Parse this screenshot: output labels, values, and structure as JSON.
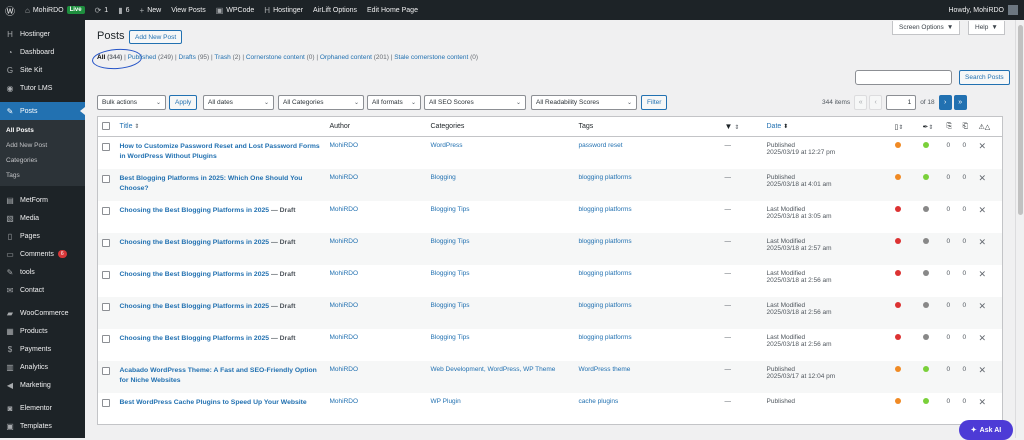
{
  "adminbar": {
    "site_name": "MohiRDO",
    "live_badge": "Live",
    "updates_count": "1",
    "comments_count": "6",
    "new_label": "New",
    "view_posts": "View Posts",
    "wpcode": "WPCode",
    "hostinger": "Hostinger",
    "airlift": "AirLift Options",
    "edit_home": "Edit Home Page",
    "howdy": "Howdy, MohiRDO"
  },
  "sidebar": {
    "items": [
      {
        "label": "Hostinger",
        "icon": "hostinger-icon"
      },
      {
        "label": "Dashboard",
        "icon": "dashboard-icon"
      },
      {
        "label": "Site Kit",
        "icon": "sitekit-icon"
      },
      {
        "label": "Tutor LMS",
        "icon": "tutor-icon"
      },
      {
        "label": "Posts",
        "icon": "pin-icon"
      },
      {
        "label": "MetForm",
        "icon": "form-icon"
      },
      {
        "label": "Media",
        "icon": "media-icon"
      },
      {
        "label": "Pages",
        "icon": "page-icon"
      },
      {
        "label": "Comments",
        "icon": "comment-icon",
        "badge": "6"
      },
      {
        "label": "tools",
        "icon": "pin-icon"
      },
      {
        "label": "Contact",
        "icon": "mail-icon"
      },
      {
        "label": "WooCommerce",
        "icon": "woo-icon"
      },
      {
        "label": "Products",
        "icon": "products-icon"
      },
      {
        "label": "Payments",
        "icon": "payments-icon"
      },
      {
        "label": "Analytics",
        "icon": "analytics-icon"
      },
      {
        "label": "Marketing",
        "icon": "megaphone-icon"
      },
      {
        "label": "Elementor",
        "icon": "elementor-icon"
      },
      {
        "label": "Templates",
        "icon": "templates-icon"
      }
    ],
    "submenu": [
      "All Posts",
      "Add New Post",
      "Categories",
      "Tags"
    ]
  },
  "header": {
    "screen_options": "Screen Options",
    "help": "Help",
    "title": "Posts",
    "add_new": "Add New Post"
  },
  "views": {
    "all": "All",
    "all_count": "(344)",
    "published": "Published",
    "published_count": "(249)",
    "drafts": "Drafts",
    "drafts_count": "(95)",
    "trash": "Trash",
    "trash_count": "(2)",
    "cornerstone": "Cornerstone content",
    "cornerstone_count": "(0)",
    "orphaned": "Orphaned content",
    "orphaned_count": "(201)",
    "stale": "Stale cornerstone content",
    "stale_count": "(0)"
  },
  "search": {
    "button": "Search Posts",
    "value": ""
  },
  "filters": {
    "bulk": "Bulk actions",
    "apply": "Apply",
    "dates": "All dates",
    "categories": "All Categories",
    "formats": "All formats",
    "seo": "All SEO Scores",
    "readability": "All Readability Scores",
    "filter": "Filter"
  },
  "pagination": {
    "items": "344 items",
    "current": "1",
    "of": "of 18"
  },
  "columns": {
    "title": "Title",
    "author": "Author",
    "categories": "Categories",
    "tags": "Tags",
    "date": "Date"
  },
  "colors": {
    "orange": "#f08a24",
    "green": "#7ad03a",
    "red": "#dc3232",
    "gray": "#888888",
    "link": "#2271b1",
    "accent": "#2271b1"
  },
  "rows": [
    {
      "title": "How to Customize Password Reset and Lost Password Forms in WordPress Without Plugins",
      "state": "",
      "author": "MohiRDO",
      "categories": "WordPress",
      "tags": "password reset",
      "comments": "—",
      "status": "Published",
      "date": "2025/03/19 at 12:27 pm",
      "seo": "orange",
      "read": "green",
      "links": "0",
      "inlinks": "0"
    },
    {
      "title": "Best Blogging Platforms in 2025: Which One Should You Choose?",
      "state": "",
      "author": "MohiRDO",
      "categories": "Blogging",
      "tags": "blogging platforms",
      "comments": "—",
      "status": "Published",
      "date": "2025/03/18 at 4:01 am",
      "seo": "orange",
      "read": "green",
      "links": "0",
      "inlinks": "0"
    },
    {
      "title": "Choosing the Best Blogging Platforms in 2025",
      "state": " — Draft",
      "author": "MohiRDO",
      "categories": "Blogging Tips",
      "tags": "blogging platforms",
      "comments": "—",
      "status": "Last Modified",
      "date": "2025/03/18 at 3:05 am",
      "seo": "red",
      "read": "gray",
      "links": "0",
      "inlinks": "0"
    },
    {
      "title": "Choosing the Best Blogging Platforms in 2025",
      "state": " — Draft",
      "author": "MohiRDO",
      "categories": "Blogging Tips",
      "tags": "blogging platforms",
      "comments": "—",
      "status": "Last Modified",
      "date": "2025/03/18 at 2:57 am",
      "seo": "red",
      "read": "gray",
      "links": "0",
      "inlinks": "0"
    },
    {
      "title": "Choosing the Best Blogging Platforms in 2025",
      "state": " — Draft",
      "author": "MohiRDO",
      "categories": "Blogging Tips",
      "tags": "blogging platforms",
      "comments": "—",
      "status": "Last Modified",
      "date": "2025/03/18 at 2:56 am",
      "seo": "red",
      "read": "gray",
      "links": "0",
      "inlinks": "0"
    },
    {
      "title": "Choosing the Best Blogging Platforms in 2025",
      "state": " — Draft",
      "author": "MohiRDO",
      "categories": "Blogging Tips",
      "tags": "blogging platforms",
      "comments": "—",
      "status": "Last Modified",
      "date": "2025/03/18 at 2:56 am",
      "seo": "red",
      "read": "gray",
      "links": "0",
      "inlinks": "0"
    },
    {
      "title": "Choosing the Best Blogging Platforms in 2025",
      "state": " — Draft",
      "author": "MohiRDO",
      "categories": "Blogging Tips",
      "tags": "blogging platforms",
      "comments": "—",
      "status": "Last Modified",
      "date": "2025/03/18 at 2:56 am",
      "seo": "red",
      "read": "gray",
      "links": "0",
      "inlinks": "0"
    },
    {
      "title": "Acabado WordPress Theme: A Fast and SEO-Friendly Option for Niche Websites",
      "state": "",
      "author": "MohiRDO",
      "categories": "Web Development, WordPress, WP Theme",
      "tags": "WordPress theme",
      "comments": "—",
      "status": "Published",
      "date": "2025/03/17 at 12:04 pm",
      "seo": "orange",
      "read": "green",
      "links": "0",
      "inlinks": "0"
    },
    {
      "title": "Best WordPress Cache Plugins to Speed Up Your Website",
      "state": "",
      "author": "MohiRDO",
      "categories": "WP Plugin",
      "tags": "cache plugins",
      "comments": "—",
      "status": "Published",
      "date": "",
      "seo": "orange",
      "read": "green",
      "links": "0",
      "inlinks": "0"
    }
  ],
  "ask_ai": "Ask AI"
}
